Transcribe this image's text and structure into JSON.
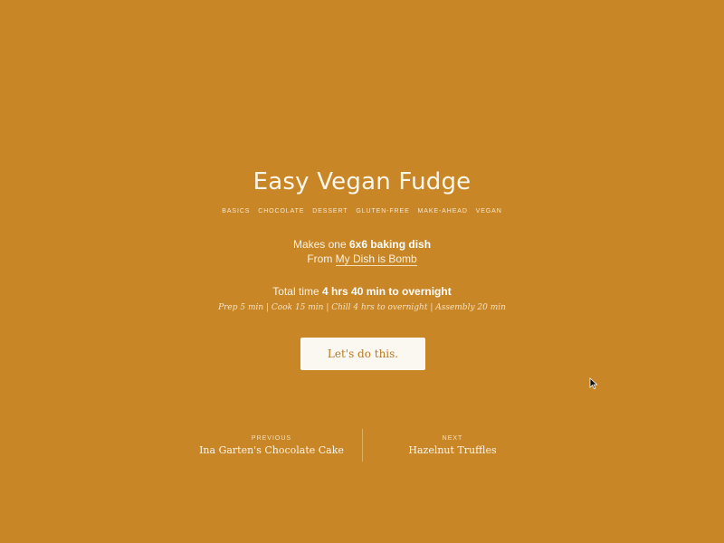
{
  "recipe": {
    "title": "Easy Vegan Fudge",
    "tags": [
      "BASICS",
      "CHOCOLATE",
      "DESSERT",
      "GLUTEN-FREE",
      "MAKE-AHEAD",
      "VEGAN"
    ],
    "yield_prefix": "Makes one",
    "yield_value": "6x6 baking dish",
    "source_prefix": "From",
    "source_name": "My Dish is Bomb",
    "time_prefix": "Total time",
    "time_value": "4 hrs 40 min to overnight",
    "time_detail": "Prep 5 min | Cook 15 min | Chill 4 hrs to overnight | Assembly 20 min"
  },
  "cta": {
    "label": "Let's do this."
  },
  "nav": {
    "previous_kicker": "PREVIOUS",
    "previous_title": "Ina Garten's Chocolate Cake",
    "next_kicker": "NEXT",
    "next_title": "Hazelnut Truffles"
  },
  "colors": {
    "background": "#c88626",
    "button_background": "#fbf7f1",
    "button_text": "#b97a25"
  },
  "icons": {
    "cursor": "mouse-pointer-icon"
  }
}
